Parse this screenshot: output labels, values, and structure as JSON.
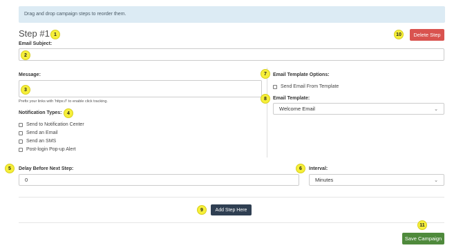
{
  "banner": {
    "text": "Drag and drop campaign steps to reorder them."
  },
  "step": {
    "title": "Step #1",
    "delete_label": "Delete Step"
  },
  "email_subject": {
    "label": "Email Subject:",
    "value": ""
  },
  "message": {
    "label": "Message:",
    "value": "",
    "help": "Prefix your links with 'https://' to enable click tracking."
  },
  "notification_types": {
    "label": "Notification Types:",
    "options": [
      {
        "label": "Send to Notification Center",
        "checked": false
      },
      {
        "label": "Send an Email",
        "checked": false
      },
      {
        "label": "Send an SMS",
        "checked": false
      },
      {
        "label": "Post-login Pop-up Alert",
        "checked": false
      }
    ]
  },
  "template_options": {
    "label": "Email Template Options:",
    "send_from_template_label": "Send Email From Template",
    "template_label": "Email Template:",
    "template_value": "Welcome Email"
  },
  "delay": {
    "label": "Delay Before Next Step:",
    "value": "0"
  },
  "interval": {
    "label": "Interval:",
    "value": "Minutes"
  },
  "add_step_label": "Add Step Here",
  "save_label": "Save Campaign",
  "badges": [
    "1",
    "2",
    "3",
    "4",
    "5",
    "6",
    "7",
    "8",
    "9",
    "10",
    "11"
  ],
  "colors": {
    "delete": "#d9534f",
    "add_step": "#2f3f52",
    "save": "#4f8a3c",
    "badge": "#f6ef3a",
    "banner": "#dcebf4"
  }
}
